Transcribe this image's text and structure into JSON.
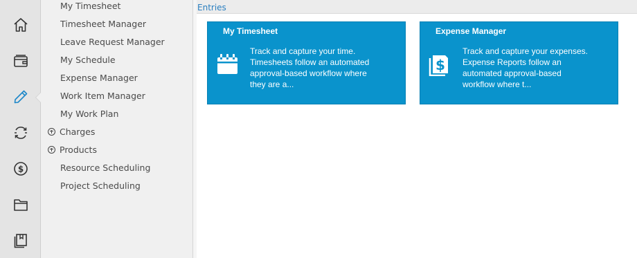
{
  "rail": {
    "items": [
      {
        "icon": "home-icon"
      },
      {
        "icon": "wallet-icon"
      },
      {
        "icon": "pencil-icon",
        "active": true
      },
      {
        "icon": "sync-icon"
      },
      {
        "icon": "dollar-icon"
      },
      {
        "icon": "folder-icon"
      },
      {
        "icon": "book-icon"
      }
    ]
  },
  "submenu": {
    "items": [
      {
        "label": "My Timesheet",
        "expandable": false
      },
      {
        "label": "Timesheet Manager",
        "expandable": false
      },
      {
        "label": "Leave Request Manager",
        "expandable": false
      },
      {
        "label": "My Schedule",
        "expandable": false
      },
      {
        "label": "Expense Manager",
        "expandable": false
      },
      {
        "label": "Work Item Manager",
        "expandable": false
      },
      {
        "label": "My Work Plan",
        "expandable": false
      },
      {
        "label": "Charges",
        "expandable": true
      },
      {
        "label": "Products",
        "expandable": true
      },
      {
        "label": "Resource Scheduling",
        "expandable": false
      },
      {
        "label": "Project Scheduling",
        "expandable": false
      }
    ]
  },
  "main": {
    "section_title": "Entries",
    "tiles": [
      {
        "title": "My Timesheet",
        "icon": "calendar-icon",
        "description": "Track and capture your time. Timesheets follow an automated approval-based workflow where they are a..."
      },
      {
        "title": "Expense Manager",
        "icon": "expense-icon",
        "description": "Track and capture your expenses. Expense Reports follow an automated approval-based workflow where t..."
      }
    ]
  },
  "colors": {
    "tile_bg": "#0a93cc",
    "link": "#2a7fc0",
    "rail_bg": "#e4e4e4",
    "active_icon": "#1e88c9"
  }
}
